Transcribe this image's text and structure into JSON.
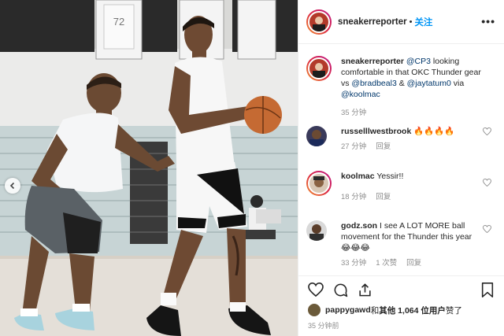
{
  "post": {
    "username": "sneakerreporter",
    "separator": "•",
    "follow_label": "关注",
    "more_label": "•••"
  },
  "caption": {
    "username": "sneakerreporter",
    "mention1": "@CP3",
    "text1": " looking comfortable in that OKC Thunder gear vs ",
    "mention2": "@bradbeal3",
    "text2": " & ",
    "mention3": "@jaytatum0",
    "text3": " via ",
    "mention4": "@koolmac",
    "time": "35 分钟"
  },
  "comments": [
    {
      "username": "russelllwestbrook",
      "text": "🔥🔥🔥🔥",
      "time": "27 分钟",
      "reply": "回复"
    },
    {
      "username": "koolmac",
      "text": "Yessir!!",
      "time": "18 分钟",
      "reply": "回复"
    },
    {
      "username": "godz.son",
      "text": "I see A LOT MORE ball movement for the Thunder this year 😂😂😂",
      "time": "33 分钟",
      "likes": "1 次赞",
      "reply": "回复"
    }
  ],
  "likes": {
    "user": "pappygawd",
    "connector": " 和 ",
    "others": "其他 1,064 位用户",
    "suffix": " 赞了"
  },
  "timestamp": "35 分钟前",
  "photo": {
    "jersey_number": "72"
  },
  "icons": [
    "heart-icon",
    "comment-icon",
    "share-icon",
    "bookmark-icon",
    "chevron-left-icon",
    "more-icon"
  ],
  "colors": {
    "follow": "#0095f6",
    "mention": "#00376b",
    "meta": "#8e8e8e"
  }
}
